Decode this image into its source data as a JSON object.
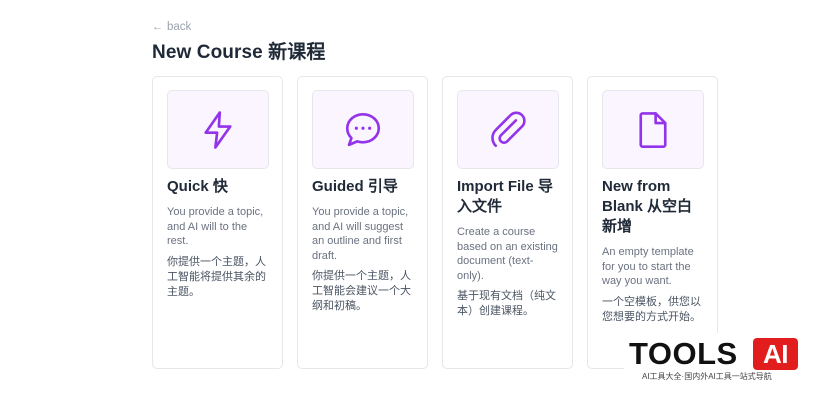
{
  "nav": {
    "back_label": "back"
  },
  "page": {
    "title": "New Course 新课程"
  },
  "cards": [
    {
      "icon": "lightning-icon",
      "title": "Quick 快",
      "description_en": "You provide a topic, and AI will to the rest.",
      "description_zh": "你提供一个主题，人工智能将提供其余的主题。"
    },
    {
      "icon": "chat-bubble-icon",
      "title": "Guided 引导",
      "description_en": "You provide a topic, and AI will suggest an outline and first draft.",
      "description_zh": "你提供一个主题，人工智能会建议一个大纲和初稿。"
    },
    {
      "icon": "paperclip-icon",
      "title": "Import File 导入文件",
      "description_en": "Create a course based on an existing document (text-only).",
      "description_zh": "基于现有文档（纯文本）创建课程。"
    },
    {
      "icon": "document-icon",
      "title": "New from Blank 从空白新增",
      "description_en": "An empty template for you to start the way you want.",
      "description_zh": "一个空模板，供您以您想要的方式开始。"
    }
  ],
  "watermark": {
    "brand": "TOOLS",
    "badge": "AI",
    "tagline": "AI工具大全·国内外AI工具一站式导航"
  },
  "colors": {
    "accent": "#9333ea",
    "tile_background": "#faf5ff",
    "card_border": "#e5e7eb",
    "watermark_badge": "#e11d1d"
  }
}
